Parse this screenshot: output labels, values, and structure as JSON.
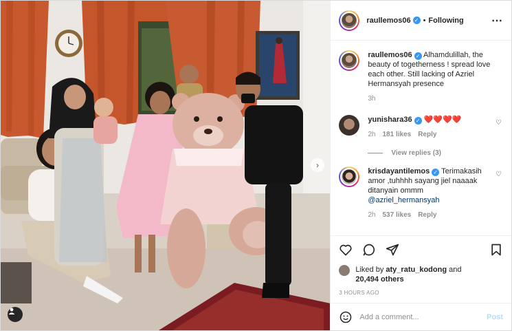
{
  "header": {
    "username": "raullemos06",
    "separator": "•",
    "follow_status": "Following",
    "more_icon": "more-horizontal-icon"
  },
  "caption": {
    "username": "raullemos06",
    "text": "Alhamdulillah, the beauty of togetherness ! spread love each other. Still lacking of Azriel Hermansyah presence",
    "time": "3h"
  },
  "comments": [
    {
      "username": "yunishara36",
      "text": "❤️❤️❤️❤️",
      "time": "2h",
      "likes": "181 likes",
      "reply": "Reply",
      "view_replies": "View replies (3)"
    },
    {
      "username": "krisdayantilemos",
      "text": "Terimakasih amor ,tuhhhh sayang jiel naaaak ditanyain ommm",
      "mention": "@azriel_hermansyah",
      "time": "2h",
      "likes": "537 likes",
      "reply": "Reply"
    }
  ],
  "actions": {
    "icons": [
      "heart-icon",
      "comment-icon",
      "share-icon",
      "bookmark-icon"
    ]
  },
  "likes": {
    "prefix": "Liked by",
    "user": "aty_ratu_kodong",
    "connector": "and",
    "others": "20,494 others"
  },
  "timestamp": "3 HOURS AGO",
  "add_comment": {
    "placeholder": "Add a comment...",
    "post_label": "Post"
  },
  "photo": {
    "next_icon": "chevron-right-icon",
    "tag_icon": "user-tag-icon"
  }
}
